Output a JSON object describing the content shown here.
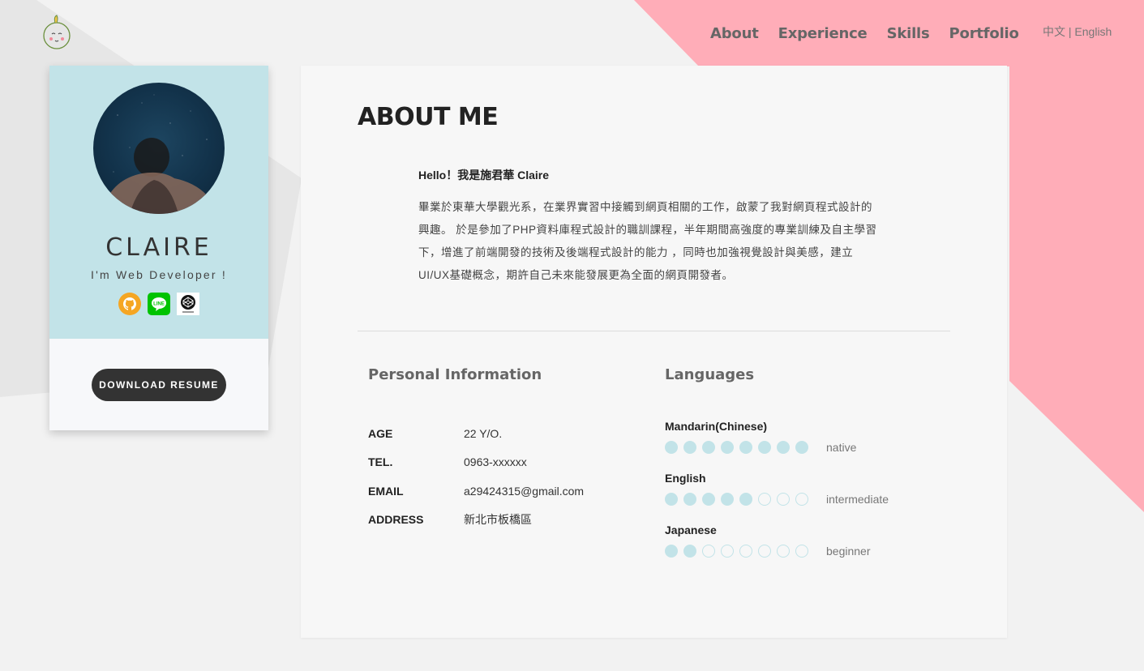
{
  "nav": {
    "items": [
      {
        "label": "About"
      },
      {
        "label": "Experience"
      },
      {
        "label": "Skills"
      },
      {
        "label": "Portfolio"
      }
    ],
    "lang_zh": "中文",
    "lang_sep": "|",
    "lang_en": "English"
  },
  "profile": {
    "name": "CLAIRE",
    "tagline": "I'm Web Developer !",
    "socials": [
      {
        "icon": "github-icon"
      },
      {
        "icon": "line-icon"
      },
      {
        "icon": "codepen-icon"
      }
    ],
    "download_label": "DOWNLOAD RESUME"
  },
  "about": {
    "title": "ABOUT ME",
    "greeting": "Hello！我是施君華 Claire",
    "bio_lines": [
      "畢業於東華大學觀光系，在業界實習中接觸到網頁相關的工作，啟蒙了我對網頁程式設計的",
      "興趣。 於是參加了PHP資料庫程式設計的職訓課程，半年期間高強度的專業訓練及自主學習",
      "下，增進了前端開發的技術及後端程式設計的能力 ，同時也加強視覺設計與美感，建立",
      "UI/UX基礎概念，期許自己未來能發展更為全面的網頁開發者。"
    ]
  },
  "personal_info": {
    "title": "Personal Information",
    "rows": [
      {
        "label": "AGE",
        "value": "22 Y/O."
      },
      {
        "label": "TEL.",
        "value": "0963-xxxxxx"
      },
      {
        "label": "EMAIL",
        "value": "a29424315@gmail.com"
      },
      {
        "label": "ADDRESS",
        "value": "新北市板橋區"
      }
    ]
  },
  "languages": {
    "title": "Languages",
    "items": [
      {
        "name": "Mandarin(Chinese)",
        "level": "native",
        "filled": 8,
        "total": 8
      },
      {
        "name": "English",
        "level": "intermediate",
        "filled": 5,
        "total": 8
      },
      {
        "name": "Japanese",
        "level": "beginner",
        "filled": 2,
        "total": 8
      }
    ]
  },
  "colors": {
    "accent_blue": "#c2e3e8",
    "accent_pink": "#ffadb8",
    "dark_button": "#333333"
  }
}
